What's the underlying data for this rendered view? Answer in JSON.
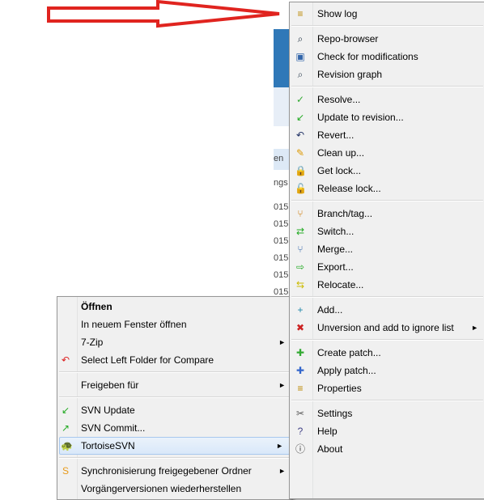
{
  "background": {
    "header_fragment": "en",
    "column_fragment": "ngs",
    "row_dates": [
      "015",
      "015",
      "015",
      "015",
      "015",
      "015"
    ]
  },
  "context_menu": {
    "items": [
      {
        "label": "Öffnen",
        "bold": true,
        "icon": ""
      },
      {
        "label": "In neuem Fenster öffnen",
        "icon": ""
      },
      {
        "label": "7-Zip",
        "icon": "",
        "submenu": true
      },
      {
        "label": "Select Left Folder for Compare",
        "icon": "undo-arrow-icon"
      },
      {
        "separator": true
      },
      {
        "label": "Freigeben für",
        "icon": "",
        "submenu": true
      },
      {
        "separator": true
      },
      {
        "label": "SVN Update",
        "icon": "svn-update-icon"
      },
      {
        "label": "SVN Commit...",
        "icon": "svn-commit-icon"
      },
      {
        "label": "TortoiseSVN",
        "icon": "tortoise-icon",
        "submenu": true,
        "highlighted": true
      },
      {
        "separator": true
      },
      {
        "label": "Synchronisierung freigegebener Ordner",
        "icon": "sync-icon",
        "submenu": true
      },
      {
        "label": "Vorgängerversionen wiederherstellen",
        "icon": ""
      }
    ]
  },
  "tortoise_menu": {
    "items": [
      {
        "label": "Show log",
        "icon": "show-log-icon"
      },
      {
        "separator": true
      },
      {
        "label": "Repo-browser",
        "icon": "repo-browser-icon"
      },
      {
        "label": "Check for modifications",
        "icon": "check-modifications-icon"
      },
      {
        "label": "Revision graph",
        "icon": "revision-graph-icon"
      },
      {
        "separator": true
      },
      {
        "label": "Resolve...",
        "icon": "resolve-icon"
      },
      {
        "label": "Update to revision...",
        "icon": "update-revision-icon"
      },
      {
        "label": "Revert...",
        "icon": "revert-icon"
      },
      {
        "label": "Clean up...",
        "icon": "cleanup-icon"
      },
      {
        "label": "Get lock...",
        "icon": "lock-icon"
      },
      {
        "label": "Release lock...",
        "icon": "unlock-icon"
      },
      {
        "separator": true
      },
      {
        "label": "Branch/tag...",
        "icon": "branch-icon"
      },
      {
        "label": "Switch...",
        "icon": "switch-icon"
      },
      {
        "label": "Merge...",
        "icon": "merge-icon"
      },
      {
        "label": "Export...",
        "icon": "export-icon"
      },
      {
        "label": "Relocate...",
        "icon": "relocate-icon"
      },
      {
        "separator": true
      },
      {
        "label": "Add...",
        "icon": "add-icon"
      },
      {
        "label": "Unversion and add to ignore list",
        "icon": "ignore-icon",
        "submenu": true
      },
      {
        "separator": true
      },
      {
        "label": "Create patch...",
        "icon": "create-patch-icon"
      },
      {
        "label": "Apply patch...",
        "icon": "apply-patch-icon"
      },
      {
        "label": "Properties",
        "icon": "properties-icon"
      },
      {
        "separator": true
      },
      {
        "label": "Settings",
        "icon": "settings-icon"
      },
      {
        "label": "Help",
        "icon": "help-icon"
      },
      {
        "label": "About",
        "icon": "about-icon"
      }
    ]
  },
  "colors": {
    "arrow": "#e0241f",
    "highlight": "#d9e8f9",
    "menu_bg": "#f0f0f0"
  }
}
